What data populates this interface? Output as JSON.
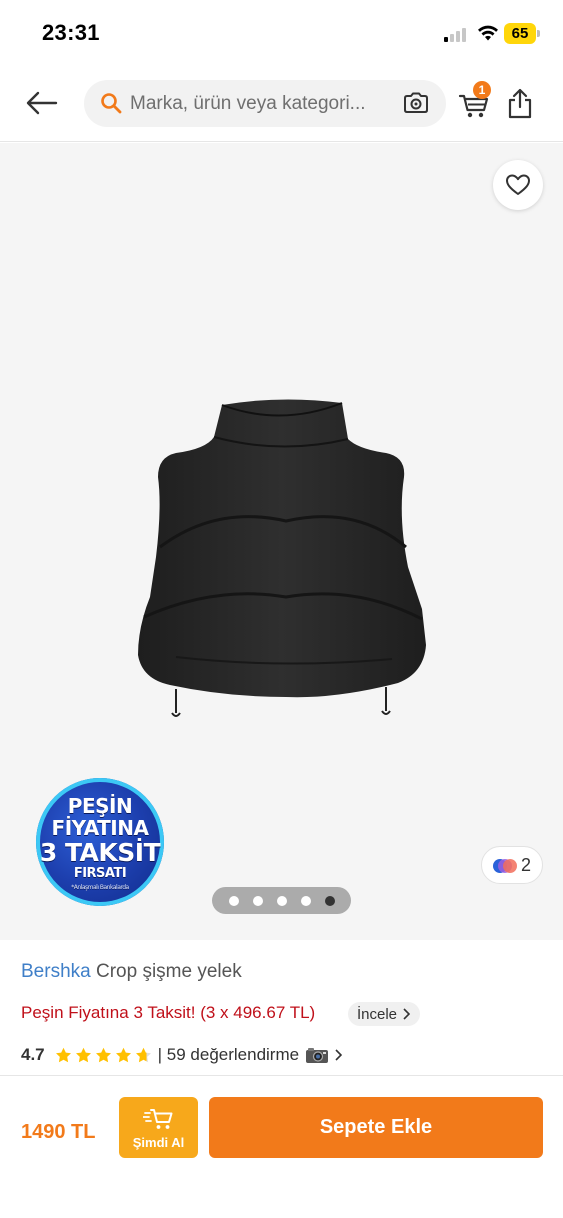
{
  "status_bar": {
    "time": "23:31",
    "battery": "65"
  },
  "header": {
    "search_placeholder": "Marka, ürün veya kategori...",
    "cart_count": "1",
    "back_icon": "arrow-left-icon",
    "search_icon": "search-icon",
    "camera_icon": "camera-icon",
    "cart_icon": "cart-icon",
    "share_icon": "share-icon"
  },
  "gallery": {
    "promo_badge": {
      "line1": "PEŞİN",
      "line2": "FİYATINA",
      "line3": "3 TAKSİT",
      "line4": "FIRSATI",
      "footnote": "*Anlaşmalı Bankalarda"
    },
    "color_count": "2",
    "page_count": 5,
    "active_page": 5,
    "favorite_icon": "heart-icon"
  },
  "product": {
    "brand": "Bershka",
    "name": "Crop şişme yelek",
    "installment_text": "Peşin Fiyatına 3 Taksit! (3 x 496.67 TL)",
    "installment_link": "İncele",
    "rating": "4.7",
    "rating_stars": 4.7,
    "review_text": "| 59 değerlendirme",
    "review_icon": "camera-emoji"
  },
  "bottom_bar": {
    "price": "1490 TL",
    "buy_now_label": "Şimdi Al",
    "add_to_cart_label": "Sepete Ekle"
  },
  "colors": {
    "brand_orange": "#f27a1a",
    "buy_now_yellow": "#f7a81b",
    "brand_blue": "#3f7fc8",
    "promo_red": "#c0101a",
    "star_gold": "#ffc000"
  }
}
